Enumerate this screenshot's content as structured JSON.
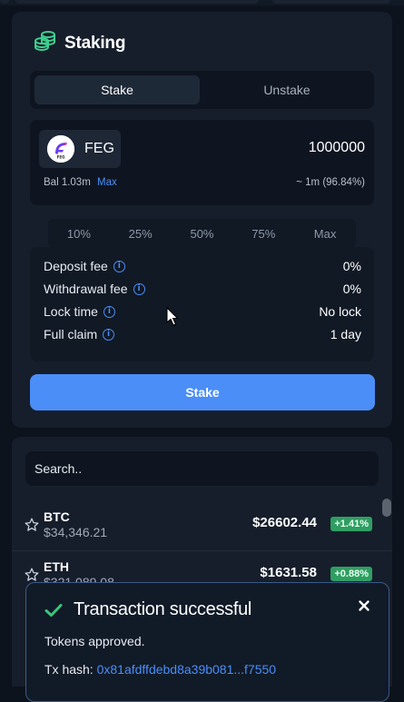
{
  "staking": {
    "title": "Staking",
    "tabs": [
      {
        "label": "Stake",
        "active": true
      },
      {
        "label": "Unstake",
        "active": false
      }
    ],
    "token": {
      "symbol": "FEG",
      "logo_text": "FEG"
    },
    "amount": "1000000",
    "balance_label": "Bal 1.03m",
    "max_label": "Max",
    "converted_value": "~ 1m (96.84%)",
    "percent_options": [
      "10%",
      "25%",
      "50%",
      "75%",
      "Max"
    ],
    "info": [
      {
        "label": "Deposit fee",
        "value": "0%"
      },
      {
        "label": "Withdrawal fee",
        "value": "0%"
      },
      {
        "label": "Lock time",
        "value": "No lock"
      },
      {
        "label": "Full claim",
        "value": "1 day"
      }
    ],
    "stake_button": "Stake"
  },
  "market": {
    "search_placeholder": "Search..",
    "coins": [
      {
        "symbol": "BTC",
        "sub_price": "$34,346.21",
        "price": "$26602.44",
        "change": "+1.41%"
      },
      {
        "symbol": "ETH",
        "sub_price": "$321,089.08",
        "price": "$1631.58",
        "change": "+0.88%"
      }
    ]
  },
  "toast": {
    "title": "Transaction successful",
    "message": "Tokens approved.",
    "hash_label": "Tx hash:",
    "hash_value": "0x81afdffdebd8a39b081...f7550",
    "close_glyph": "✕"
  },
  "colors": {
    "accent": "#4b8ef7",
    "positive": "#2f9e62",
    "success_check": "#3cc47c",
    "staking_icon": "#3ecf8e",
    "background": "#0d131d",
    "card": "#161e2b"
  },
  "icons": {
    "header": "coin-stack-icon",
    "info": "info-circle-icon",
    "favorite": "star-outline-icon",
    "toast_status": "checkmark-icon",
    "toast_close": "close-icon"
  }
}
